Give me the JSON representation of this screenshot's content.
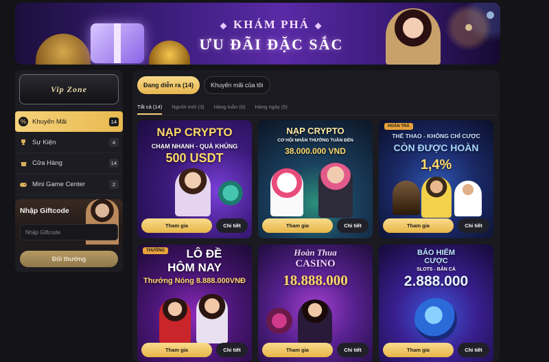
{
  "banner": {
    "title": "KHÁM PHÁ",
    "subtitle": "ƯU ĐÃI ĐẶC SẮC"
  },
  "sidebar": {
    "vip_label": "Vip Zone",
    "items": [
      {
        "label": "Khuyến Mãi",
        "count": "14",
        "icon": "percent-icon",
        "active": true
      },
      {
        "label": "Sự Kiện",
        "count": "4",
        "icon": "trophy-icon",
        "active": false
      },
      {
        "label": "Cửa Hàng",
        "count": "14",
        "icon": "shop-icon",
        "active": false
      },
      {
        "label": "Mini Game Center",
        "count": "2",
        "icon": "gamepad-icon",
        "active": false
      }
    ]
  },
  "giftcode": {
    "title": "Nhập Giftcode",
    "placeholder": "Nhập Giftcode",
    "button": "Đổi thưởng"
  },
  "tabs": {
    "pills": [
      {
        "label": "Đang diễn ra (14)",
        "active": true
      },
      {
        "label": "Khuyến mãi của tôi",
        "active": false
      }
    ],
    "subtabs": [
      {
        "label": "Tất cả (14)",
        "active": true
      },
      {
        "label": "Người mới (3)",
        "active": false
      },
      {
        "label": "Hàng tuần (6)",
        "active": false
      },
      {
        "label": "Hàng ngày (5)",
        "active": false
      }
    ]
  },
  "promos": [
    {
      "line1": "NẠP CRYPTO",
      "line2": "CHẠM NHANH - QUÀ KHỦNG",
      "line3": "500 USDT",
      "join": "Tham gia",
      "detail": "Chi tiết"
    },
    {
      "line1": "NẠP CRYPTO",
      "line2": "CƠ HỘI NHẬN THƯỞNG TUẦN ĐẾN",
      "line3": "38.000.000 VND",
      "join": "Tham gia",
      "detail": "Chi tiết"
    },
    {
      "tag": "HOÀN TRẢ",
      "line1": "THỂ THAO - KHÔNG CHỈ CƯỢC",
      "line2": "CÒN ĐƯỢC HOÀN",
      "line3": "1,4%",
      "join": "Tham gia",
      "detail": "Chi tiết"
    },
    {
      "tag": "THƯỞNG",
      "line1": "LÔ ĐỀ",
      "line2": "HÔM NAY",
      "line3": "Thưởng Nóng 8.888.000VNĐ",
      "join": "Tham gia",
      "detail": "Chi tiết"
    },
    {
      "line1": "Hoàn Thua",
      "line2": "CASINO",
      "line3": "18.888.000",
      "join": "Tham gia",
      "detail": "Chi tiết"
    },
    {
      "line1": "BẢO HIỂM CƯỢC",
      "line2": "SLOTS - BẮN CÁ",
      "line3": "2.888.000",
      "join": "Tham gia",
      "detail": "Chi tiết"
    }
  ],
  "colors": {
    "accent": "#f3cf77",
    "background": "#141418",
    "panel": "#1a1a20"
  }
}
